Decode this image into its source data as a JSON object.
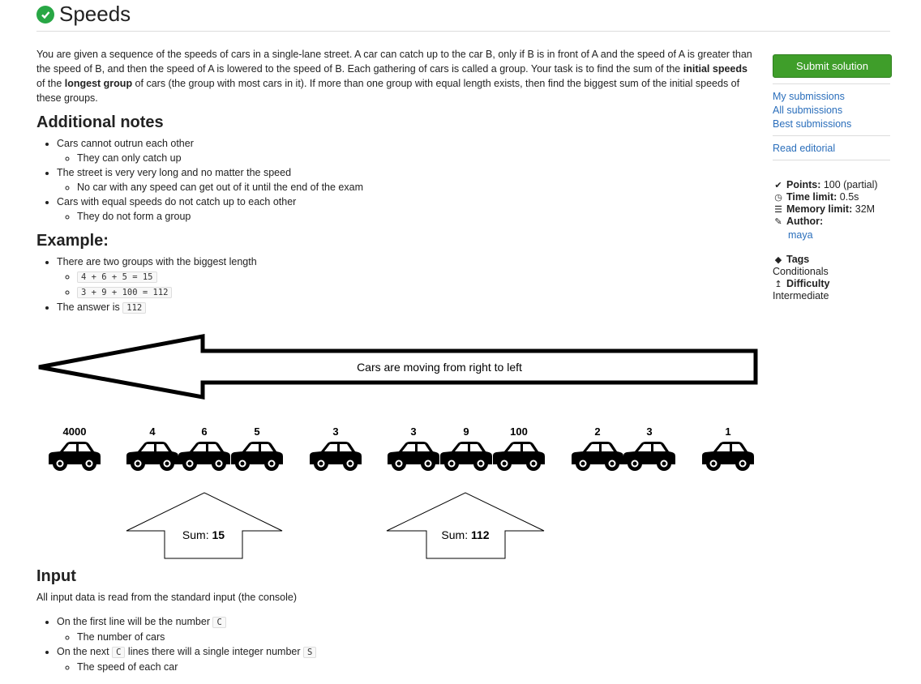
{
  "title": "Speeds",
  "description": {
    "p1": "You are given a sequence of the speeds of cars in a single-lane street. A car can catch up to the car B, only if B is in front of A and the speed of A is greater than the speed of B, and then the speed of A is lowered to the speed of B. Each gathering of cars is called a group. Your task is to find the sum of the ",
    "b1": "initial speeds",
    "p2": " of the ",
    "b2": "longest group",
    "p3": " of cars (the group with most cars in it). If more than one group with equal length exists, then find the biggest sum of the initial speeds of these groups."
  },
  "notes": {
    "heading": "Additional notes",
    "items": [
      {
        "text": "Cars cannot outrun each other",
        "sub": "They can only catch up"
      },
      {
        "text": "The street is very very long and no matter the speed",
        "sub": "No car with any speed can get out of it until the end of the exam"
      },
      {
        "text": "Cars with equal speeds do not catch up to each other",
        "sub": "They do not form a group"
      }
    ]
  },
  "example": {
    "heading": "Example:",
    "item1": "There are two groups with the biggest length",
    "code1": "4 + 6 + 5 = 15",
    "code2": "3 + 9 + 100 = 112",
    "item2": "The answer is ",
    "answer": "112"
  },
  "diagram": {
    "arrow_text": "Cars are moving from right to left",
    "speeds": [
      "4000",
      "4",
      "6",
      "5",
      "3",
      "3",
      "9",
      "100",
      "2",
      "3",
      "1"
    ],
    "sum_label": "Sum: ",
    "sum1": "15",
    "sum2": "112"
  },
  "input": {
    "heading": "Input",
    "intro": "All input data is read from the standard input (the console)",
    "line1_pre": "On the first line will be the number ",
    "line1_code": "C",
    "line1_sub": "The number of cars",
    "line2_pre": "On the next ",
    "line2_code": "C",
    "line2_mid": " lines there will a single integer number ",
    "line2_code2": "S",
    "line2_sub": "The speed of each car"
  },
  "sidebar": {
    "submit_label": "Submit solution",
    "links": [
      "My submissions",
      "All submissions",
      "Best submissions"
    ],
    "editorial": "Read editorial",
    "points_label": "Points:",
    "points_value": "100 (partial)",
    "time_label": "Time limit:",
    "time_value": "0.5s",
    "memory_label": "Memory limit:",
    "memory_value": "32M",
    "author_label": "Author:",
    "author_value": "maya",
    "tags_label": "Tags",
    "tags_value": "Conditionals",
    "difficulty_label": "Difficulty",
    "difficulty_value": "Intermediate"
  },
  "colors": {
    "accent": "#3f9e2a",
    "link": "#2a6ebb"
  }
}
